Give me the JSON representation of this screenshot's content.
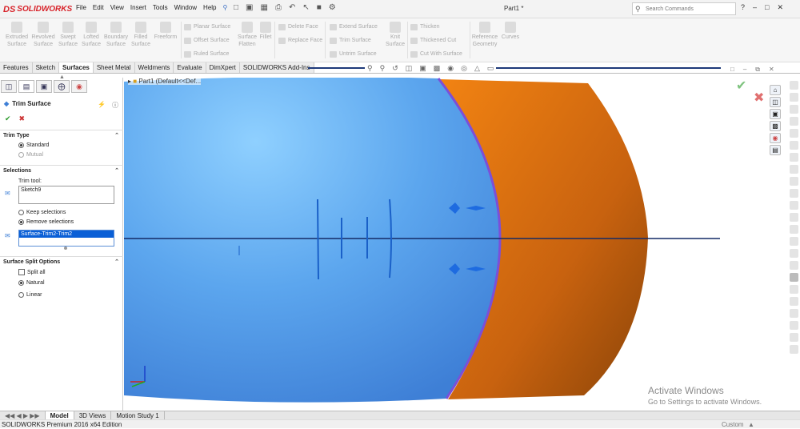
{
  "app": {
    "logo_ds": "DS",
    "logo_text": "SOLIDWORKS",
    "doc_title": "Part1 *"
  },
  "menu": [
    "File",
    "Edit",
    "View",
    "Insert",
    "Tools",
    "Window",
    "Help"
  ],
  "search": {
    "placeholder": "Search Commands"
  },
  "ribbon": {
    "big_buttons": [
      {
        "line1": "Extruded",
        "line2": "Surface"
      },
      {
        "line1": "Revolved",
        "line2": "Surface"
      },
      {
        "line1": "Swept",
        "line2": "Surface"
      },
      {
        "line1": "Lofted",
        "line2": "Surface"
      },
      {
        "line1": "Boundary",
        "line2": "Surface"
      },
      {
        "line1": "Filled",
        "line2": "Surface"
      },
      {
        "line1": "Freeform",
        "line2": ""
      }
    ],
    "col1": [
      "Planar Surface",
      "Offset Surface",
      "Ruled Surface"
    ],
    "col2_big": {
      "line1": "Surface",
      "line2": "Flatten"
    },
    "fillet": "Fillet",
    "col3": [
      "Delete Face",
      "Replace Face"
    ],
    "col4": [
      "Extend Surface",
      "Trim Surface",
      "Untrim Surface"
    ],
    "knit": {
      "line1": "Knit",
      "line2": "Surface"
    },
    "col5": [
      "Thicken",
      "Thickened Cut",
      "Cut With Surface"
    ],
    "refgeom": {
      "line1": "Reference",
      "line2": "Geometry"
    },
    "curves": "Curves"
  },
  "tabs": [
    "Features",
    "Sketch",
    "Surfaces",
    "Sheet Metal",
    "Weldments",
    "Evaluate",
    "DimXpert",
    "SOLIDWORKS Add-Ins"
  ],
  "active_tab": "Surfaces",
  "tree": {
    "item": "Part1  (Default<<Def..."
  },
  "pm": {
    "title": "Trim Surface",
    "trim_type": {
      "header": "Trim Type",
      "options": [
        "Standard",
        "Mutual"
      ]
    },
    "selections": {
      "header": "Selections",
      "tool_label": "Trim tool:",
      "tool_value": "Sketch9",
      "keep": "Keep selections",
      "remove": "Remove selections",
      "list_value": "Surface-Trim2-Trim2"
    },
    "split": {
      "header": "Surface Split Options",
      "split_all": "Split all",
      "natural": "Natural",
      "linear": "Linear"
    }
  },
  "bottom_tabs": [
    "Model",
    "3D Views",
    "Motion Study 1"
  ],
  "status": {
    "text": "SOLIDWORKS Premium 2016 x64 Edition",
    "custom": "Custom"
  },
  "activate": {
    "line1": "Activate Windows",
    "line2": "Go to Settings to activate Windows."
  },
  "colors": {
    "blue_surface": "#5fa8ef",
    "orange_surface": "#d26a12",
    "edge": "#7b4fd8",
    "selection": "#0a5fd6"
  }
}
